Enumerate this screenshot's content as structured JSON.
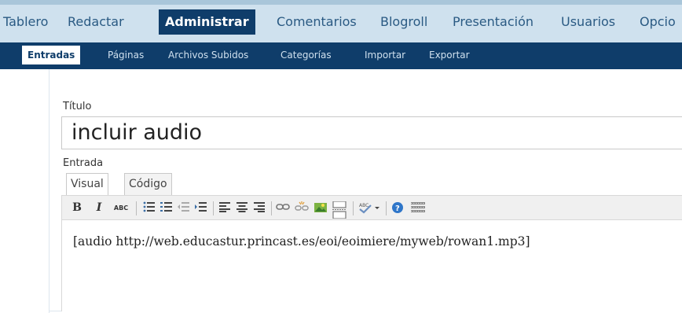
{
  "topmenu": {
    "items": [
      "Tablero",
      "Redactar",
      "Administrar",
      "Comentarios",
      "Blogroll",
      "Presentación",
      "Usuarios",
      "Opcio"
    ]
  },
  "submenu": {
    "items": [
      "Entradas",
      "Páginas",
      "Archivos Subidos",
      "Categorías",
      "Importar",
      "Exportar"
    ]
  },
  "form": {
    "title_label": "Título",
    "title_value": "incluir audio",
    "entry_label": "Entrada",
    "tabs": [
      "Visual",
      "Código"
    ],
    "content": "[audio http://web.educastur.princast.es/eoi/eoimiere/myweb/rowan1.mp3]"
  },
  "toolbar": {
    "bold": "B",
    "italic": "I",
    "strike": "ABC"
  },
  "colors": {
    "topmenu_bg": "#cfe1ee",
    "active_bg": "#0f3d6a",
    "link": "#2a5a83"
  }
}
